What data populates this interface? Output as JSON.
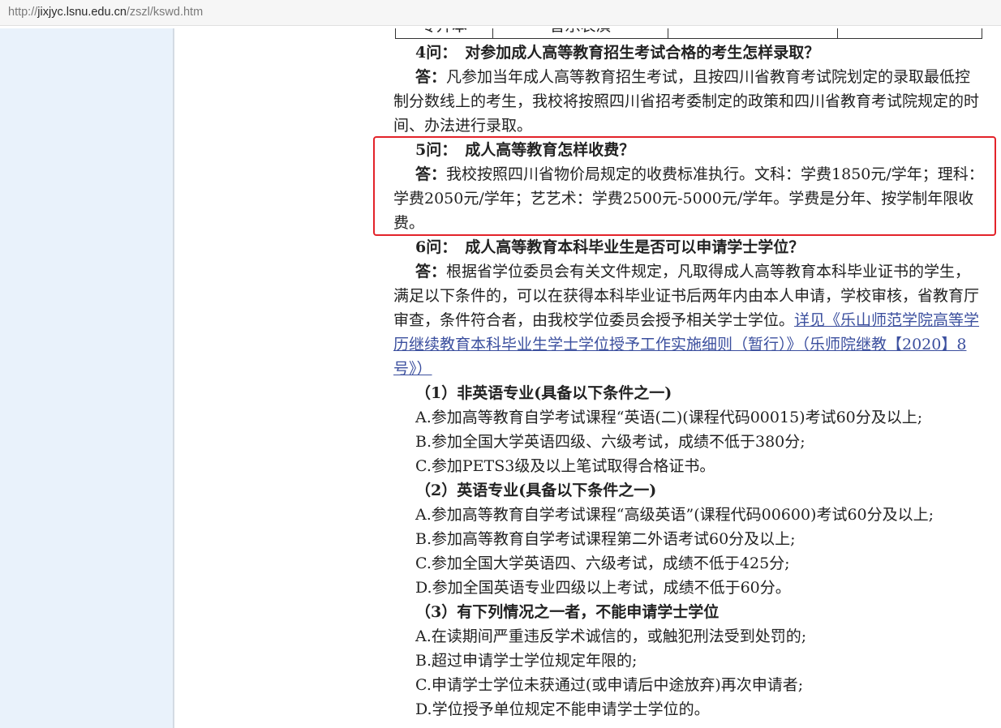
{
  "browser": {
    "url_scheme": "http://",
    "url_host": "jixjyc.lsnu.edu.cn",
    "url_path": "/zszl/kswd.htm"
  },
  "colors": {
    "text": "#222222",
    "link": "#3b4f9e",
    "highlight": "#e3232a",
    "side_panel": "#e9f2fb",
    "table_border": "#333333"
  },
  "table_fragment": {
    "level": "专升本",
    "major": "音乐表演"
  },
  "faq": [
    {
      "label": "4问：",
      "question": "对参加成人高等教育招生考试合格的考生怎样录取？",
      "answer_label": "答：",
      "answer_lines": [
        "凡参加当年成人高等教育招生考试，且按四川省教育考试院划定的录取最低控",
        "制分数线上的考生，我校将按照四川省招考委制定的政策和四川省教育考试院规定的时",
        "间、办法进行录取。"
      ]
    },
    {
      "label": "5问：",
      "question": "成人高等教育怎样收费？",
      "answer_label": "答：",
      "answer_lines": [
        "我校按照四川省物价局规定的收费标准执行。文科：学费1850元/学年；理科：",
        "学费2050元/学年；艺艺术：学费2500元-5000元/学年。学费是分年、按学制年限收",
        "费。"
      ]
    },
    {
      "label": "6问：",
      "question": "成人高等教育本科毕业生是否可以申请学士学位？",
      "answer_label": "答：",
      "answer_lines": [
        "根据省学位委员会有关文件规定，凡取得成人高等教育本科毕业证书的学生，",
        "满足以下条件的，可以在获得本科毕业证书后两年内由本人申请，学校审核，省教育厅",
        "审查，条件符合者，由我校学位委员会授予相关学士学位。"
      ],
      "link_lines": [
        "详见《乐山师范学院高等学",
        "历继续教育本科毕业生学士学位授予工作实施细则（暂行）》（乐师院继教【2020】8",
        "号》）"
      ],
      "conditions": [
        {
          "heading": "（1）非英语专业(具备以下条件之一)",
          "items": [
            "A.参加高等教育自学考试课程“英语(二)(课程代码00015)考试60分及以上;",
            "B.参加全国大学英语四级、六级考试，成绩不低于380分;",
            "C.参加PETS3级及以上笔试取得合格证书。"
          ]
        },
        {
          "heading": "（2）英语专业(具备以下条件之一)",
          "items": [
            "A.参加高等教育自学考试课程“高级英语”(课程代码00600)考试60分及以上;",
            "B.参加高等教育自学考试课程第二外语考试60分及以上;",
            "C.参加全国大学英语四、六级考试，成绩不低于425分;",
            "D.参加全国英语专业四级以上考试，成绩不低于60分。"
          ]
        },
        {
          "heading": "（3）有下列情况之一者，不能申请学士学位",
          "items": [
            "A.在读期间严重违反学术诚信的，或触犯刑法受到处罚的;",
            "B.超过申请学士学位规定年限的;",
            "C.申请学士学位未获通过(或申请后中途放弃)再次申请者;",
            "D.学位授予单位规定不能申请学士学位的。"
          ]
        }
      ]
    }
  ]
}
